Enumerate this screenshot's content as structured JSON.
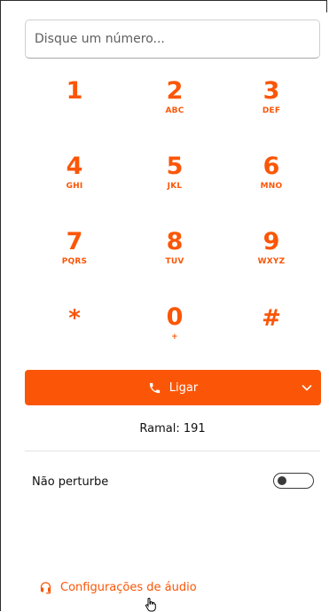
{
  "dialer": {
    "input_placeholder": "Disque um número...",
    "input_value": ""
  },
  "keypad": [
    {
      "digit": "1",
      "letters": ""
    },
    {
      "digit": "2",
      "letters": "ABC"
    },
    {
      "digit": "3",
      "letters": "DEF"
    },
    {
      "digit": "4",
      "letters": "GHI"
    },
    {
      "digit": "5",
      "letters": "JKL"
    },
    {
      "digit": "6",
      "letters": "MNO"
    },
    {
      "digit": "7",
      "letters": "PQRS"
    },
    {
      "digit": "8",
      "letters": "TUV"
    },
    {
      "digit": "9",
      "letters": "WXYZ"
    },
    {
      "digit": "*",
      "letters": ""
    },
    {
      "digit": "0",
      "letters": "+"
    },
    {
      "digit": "#",
      "letters": ""
    }
  ],
  "call": {
    "label": "Ligar",
    "icon": "phone-icon",
    "dropdown_icon": "chevron-down-icon"
  },
  "extension": {
    "text": "Ramal: 191"
  },
  "do_not_disturb": {
    "label": "Não perturbe",
    "enabled": false
  },
  "audio_settings": {
    "label": "Configurações de áudio",
    "icon": "headset-icon"
  },
  "colors": {
    "accent": "#fb5607",
    "text": "#111111",
    "divider": "#e4e4e4",
    "toggle": "#3a3a3a"
  }
}
